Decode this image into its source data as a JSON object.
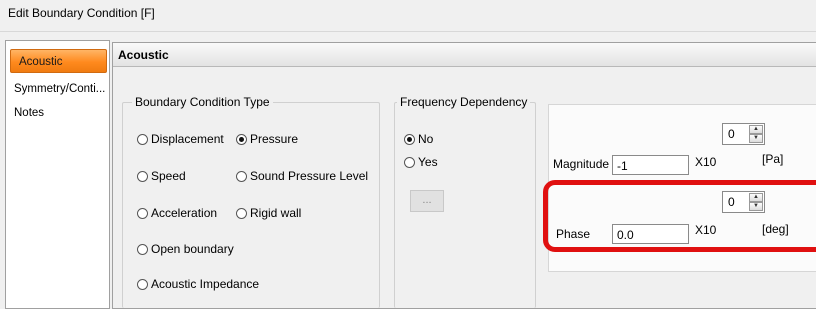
{
  "window": {
    "title": "Edit Boundary Condition [F]"
  },
  "sidebar": {
    "items": [
      {
        "label": "Acoustic",
        "active": true
      },
      {
        "label": "Symmetry/Conti...",
        "active": false
      },
      {
        "label": "Notes",
        "active": false
      }
    ]
  },
  "panel": {
    "header": "Acoustic"
  },
  "bc_type": {
    "legend": "Boundary Condition Type",
    "options": [
      {
        "label": "Displacement",
        "checked": false
      },
      {
        "label": "Pressure",
        "checked": true
      },
      {
        "label": "Speed",
        "checked": false
      },
      {
        "label": "Sound Pressure Level",
        "checked": false
      },
      {
        "label": "Acceleration",
        "checked": false
      },
      {
        "label": "Rigid wall",
        "checked": false
      },
      {
        "label": "Open boundary",
        "checked": false
      },
      {
        "label": "Acoustic Impedance",
        "checked": false
      }
    ]
  },
  "frequency": {
    "legend": "Frequency Dependency",
    "options": [
      {
        "label": "No",
        "checked": true
      },
      {
        "label": "Yes",
        "checked": false
      }
    ],
    "button_label": "..."
  },
  "magnitude": {
    "label": "Magnitude",
    "value": "-1",
    "multiplier": "X10",
    "exponent": "0",
    "unit": "[Pa]"
  },
  "phase": {
    "label": "Phase",
    "value": "0.0",
    "multiplier": "X10",
    "exponent": "0",
    "unit": "[deg]"
  },
  "colors": {
    "accent": "#ff8a1e",
    "highlight": "#e01010"
  }
}
